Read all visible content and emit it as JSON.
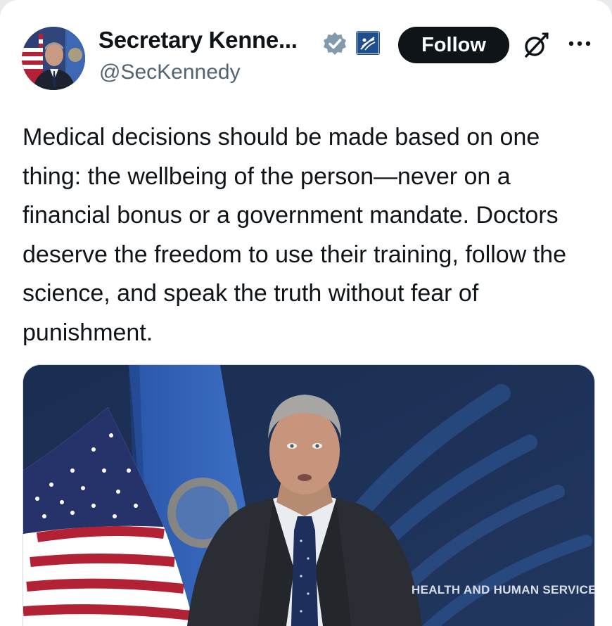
{
  "post": {
    "author": {
      "display_name": "Secretary Kenne...",
      "handle": "@SecKennedy"
    },
    "follow_label": "Follow",
    "text": "Medical decisions should be made based on one thing: the wellbeing of the person—never on a financial bonus or a government mandate. Doctors deserve the freedom to use their training, follow the science, and speak the truth without fear of punishment.",
    "media": {
      "caption_text": "HEALTH AND HUMAN SERVICES"
    }
  },
  "icons": {
    "verified": "verified-badge-icon",
    "affiliate": "hhs-affiliate-icon",
    "grok": "grok-icon",
    "more": "more-icon"
  },
  "colors": {
    "follow_bg": "#0f1419",
    "handle": "#536471",
    "verified_badge": "#829aab"
  }
}
